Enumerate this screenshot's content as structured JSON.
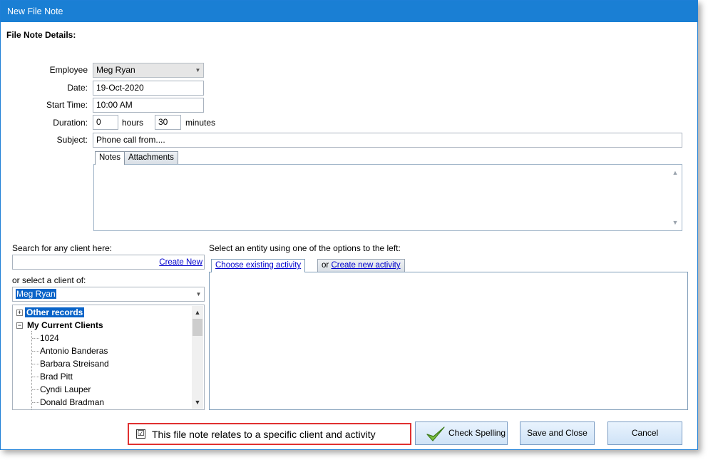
{
  "window": {
    "title": "New File Note"
  },
  "section_heading": "File Note Details:",
  "form": {
    "employee_label": "Employee",
    "employee_value": "Meg Ryan",
    "date_label": "Date:",
    "date_value": "19-Oct-2020",
    "start_time_label": "Start Time:",
    "start_time_value": "10:00 AM",
    "duration_label": "Duration:",
    "duration_hours": "0",
    "hours_label": "hours",
    "duration_minutes": "30",
    "minutes_label": "minutes",
    "subject_label": "Subject:",
    "subject_value": "Phone call from...."
  },
  "note_tabs": {
    "notes": "Notes",
    "attachments": "Attachments"
  },
  "client_search": {
    "label": "Search for any client here:",
    "create_new": "Create New",
    "select_label": "or select a client of:",
    "select_value": "Meg Ryan"
  },
  "tree": {
    "other_records": "Other records",
    "my_current_clients": "My Current Clients",
    "clients": [
      "1024",
      "Antonio Banderas",
      "Barbara Streisand",
      "Brad Pitt",
      "Cyndi Lauper",
      "Donald Bradman"
    ]
  },
  "entity": {
    "label": "Select an entity using one of the options to the left:",
    "choose_existing": "Choose existing activity",
    "or_text": "or",
    "create_new_activity": "Create new activity"
  },
  "footer": {
    "relates_checkbox_label": "This file note relates to a specific client and activity",
    "check_mark": "☑",
    "check_spelling": "Check Spelling",
    "save_and_close": "Save and Close",
    "cancel": "Cancel"
  },
  "colors": {
    "titlebar": "#1a7fd4",
    "selection": "#0a64c8",
    "highlight_border": "#e03030"
  }
}
